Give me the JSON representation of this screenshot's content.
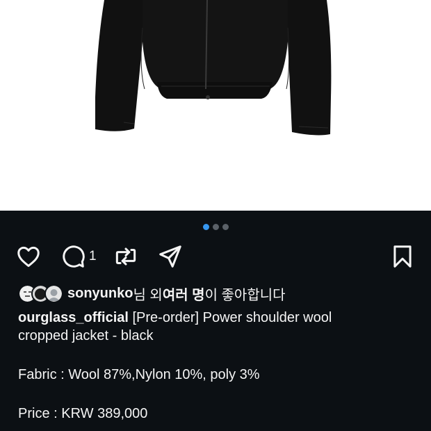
{
  "carousel": {
    "count": 3,
    "active_index": 0
  },
  "actions": {
    "like_icon": "heart-icon",
    "comment_icon": "comment-icon",
    "comment_count": "1",
    "repost_icon": "repost-icon",
    "share_icon": "share-icon",
    "save_icon": "bookmark-icon"
  },
  "likes": {
    "username": "sonyunko",
    "text_1": "님 외 ",
    "text_bold": "여러 명",
    "text_2": "이 좋아합니다"
  },
  "caption": {
    "username": "ourglass_official",
    "line1": "[Pre-order] Power shoulder wool",
    "line2": "cropped jacket - black",
    "fabric": "Fabric : Wool 87%,Nylon 10%, poly 3%",
    "price": "Price : KRW 389,000"
  },
  "colors": {
    "background": "#0c1014",
    "text": "#f5f5f5",
    "accent": "#3797f0"
  }
}
